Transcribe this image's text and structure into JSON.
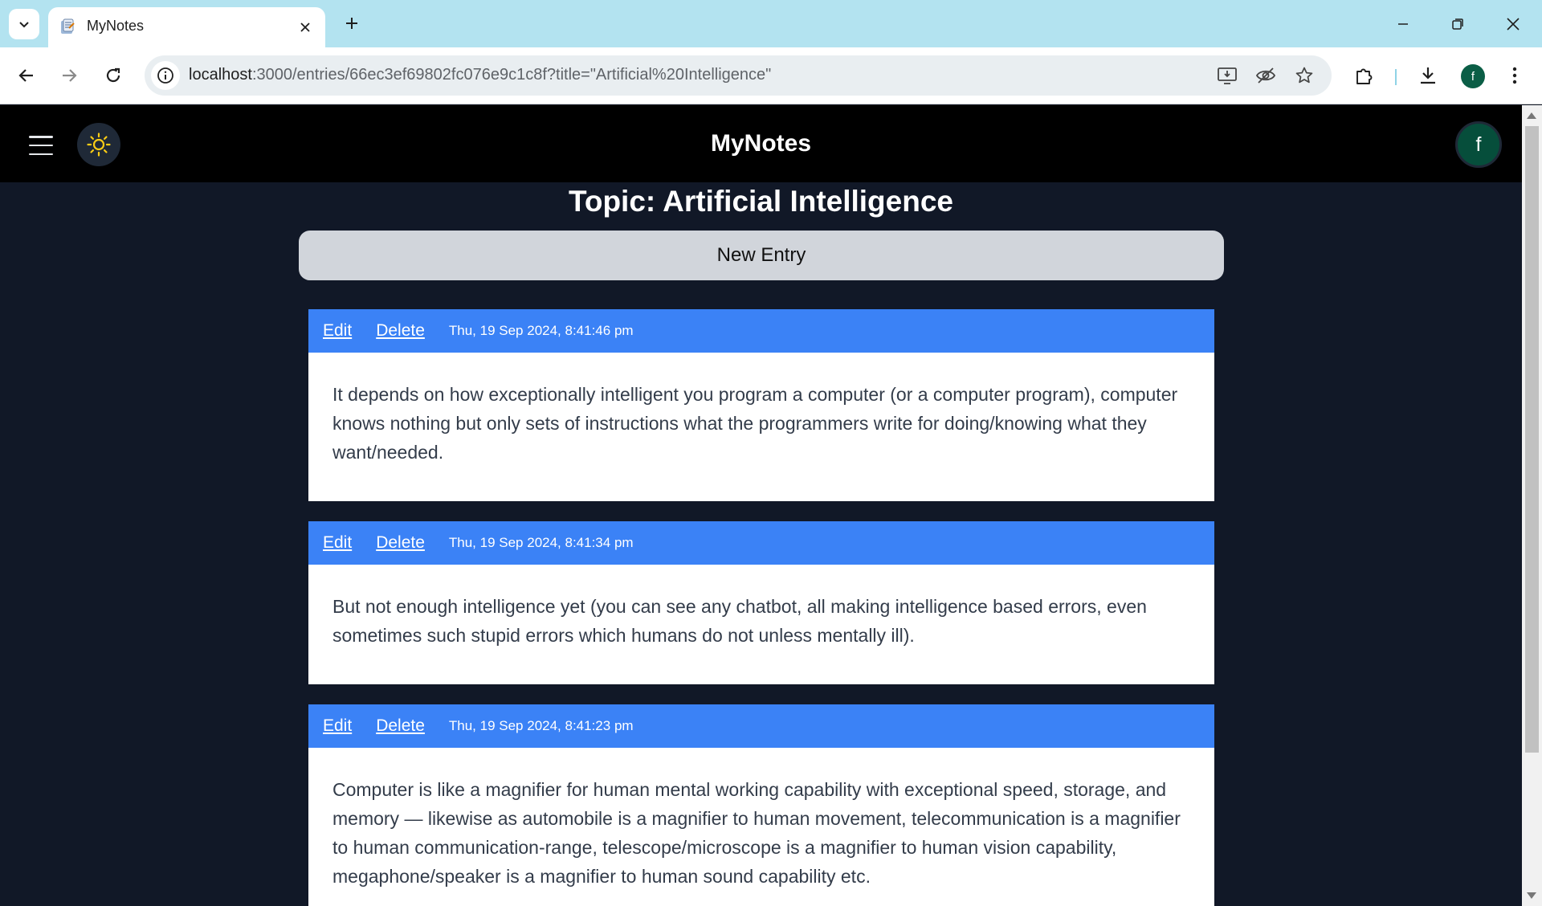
{
  "browser": {
    "tab_title": "MyNotes",
    "url_host": "localhost",
    "url_rest": ":3000/entries/66ec3ef69802fc076e9c1c8f?title=\"Artificial%20Intelligence\"",
    "profile_initial": "f"
  },
  "header": {
    "app_title": "MyNotes",
    "avatar_initial": "f"
  },
  "page": {
    "topic_title": "Topic: Artificial Intelligence",
    "new_entry_label": "New Entry"
  },
  "entries": [
    {
      "edit_label": "Edit",
      "delete_label": "Delete",
      "timestamp": "Thu, 19 Sep 2024, 8:41:46 pm",
      "text": "It depends on how exceptionally intelligent you program a computer (or a computer program), computer knows nothing but only sets of instructions what the programmers write for doing/knowing what they want/needed."
    },
    {
      "edit_label": "Edit",
      "delete_label": "Delete",
      "timestamp": "Thu, 19 Sep 2024, 8:41:34 pm",
      "text": "But not enough intelligence yet (you can see any chatbot, all making intelligence based errors, even sometimes such stupid errors which humans do not unless mentally ill)."
    },
    {
      "edit_label": "Edit",
      "delete_label": "Delete",
      "timestamp": "Thu, 19 Sep 2024, 8:41:23 pm",
      "text": "Computer is like a magnifier for human mental working capability with exceptional speed, storage, and memory — likewise as automobile is a magnifier to human movement, telecommunication is a magnifier to human communication-range, telescope/microscope is a magnifier to human vision capability, megaphone/speaker is a magnifier to human sound capability etc."
    }
  ],
  "colors": {
    "header_bg": "#000000",
    "page_bg": "#111827",
    "entry_bar": "#3b82f6",
    "new_entry_bg": "#d1d5db",
    "theme_icon": "#facc15"
  }
}
